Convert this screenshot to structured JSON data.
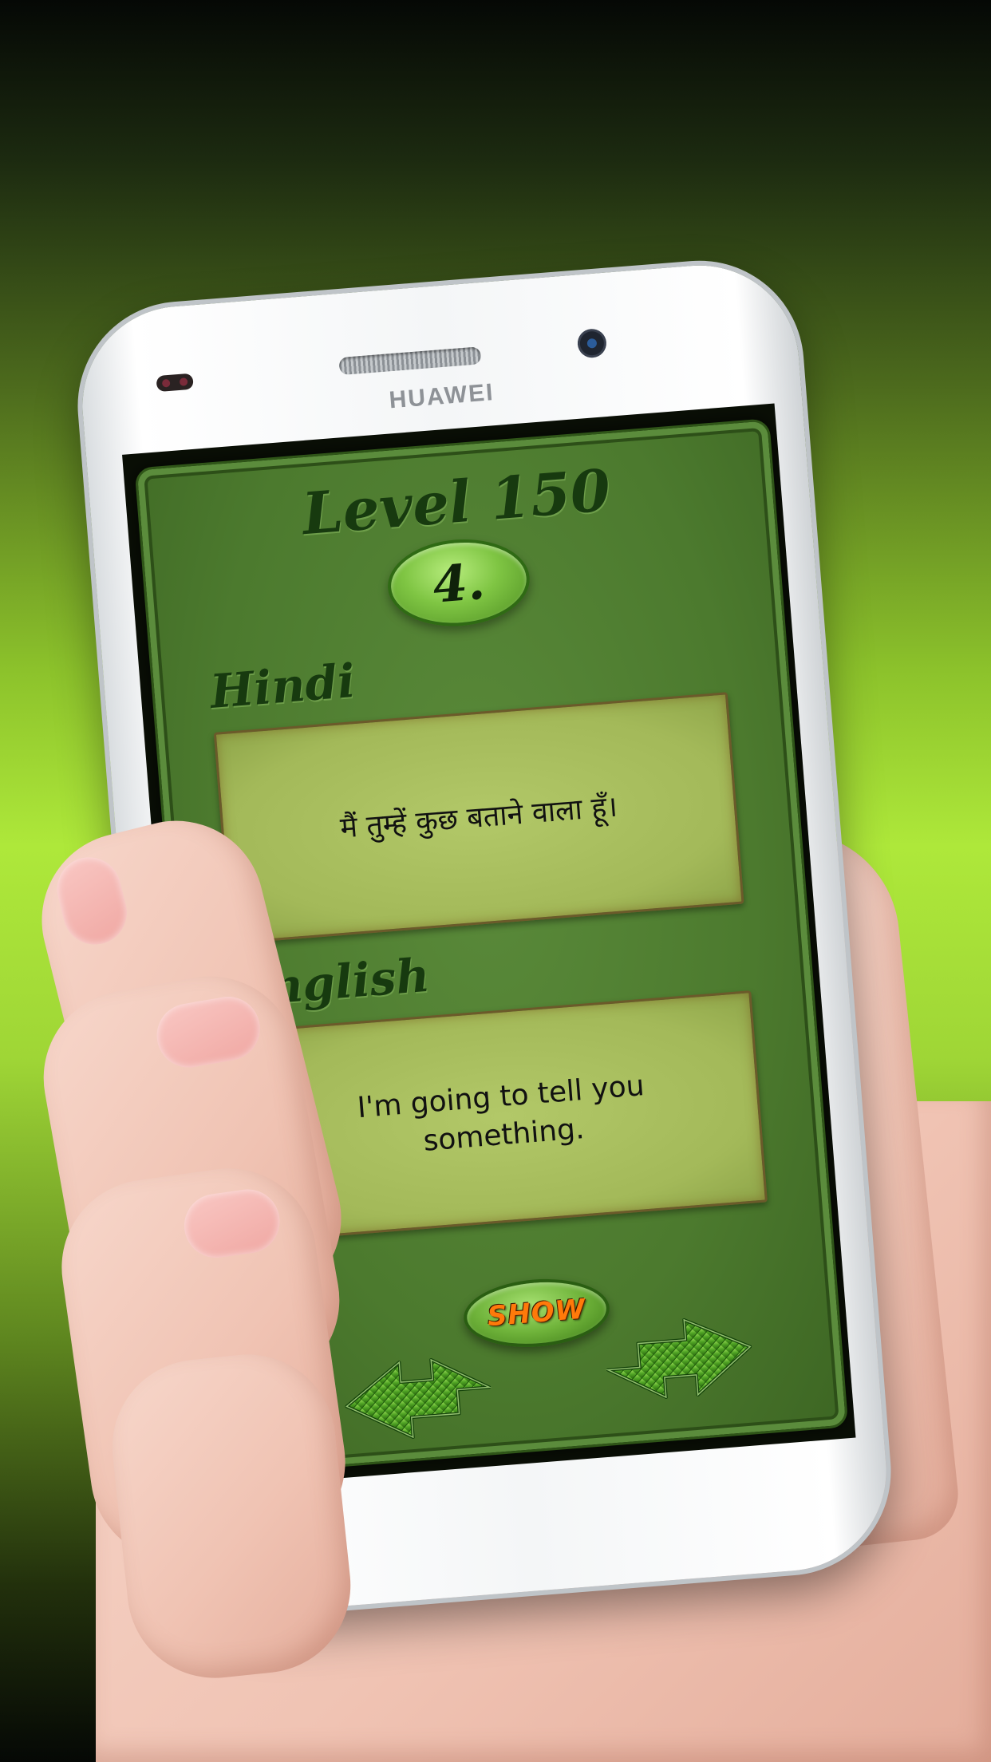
{
  "device": {
    "brand": "HUAWEI"
  },
  "app": {
    "level_title": "Level 150",
    "question_number": "4.",
    "hindi": {
      "label": "Hindi",
      "text": "मैं तुम्हें कुछ बताने वाला हूँ।"
    },
    "english": {
      "label": "English",
      "text": "I'm going to tell you something."
    },
    "show_button_label": "SHOW",
    "navigation": {
      "prev_icon": "double-arrow-left-icon",
      "next_icon": "double-arrow-right-icon"
    }
  },
  "colors": {
    "panel_green": "#4c7a2e",
    "card_olive": "#a3b959",
    "label_dark_green": "#173a0f",
    "show_orange": "#ff7a0a",
    "background_lime": "#aee83a"
  }
}
